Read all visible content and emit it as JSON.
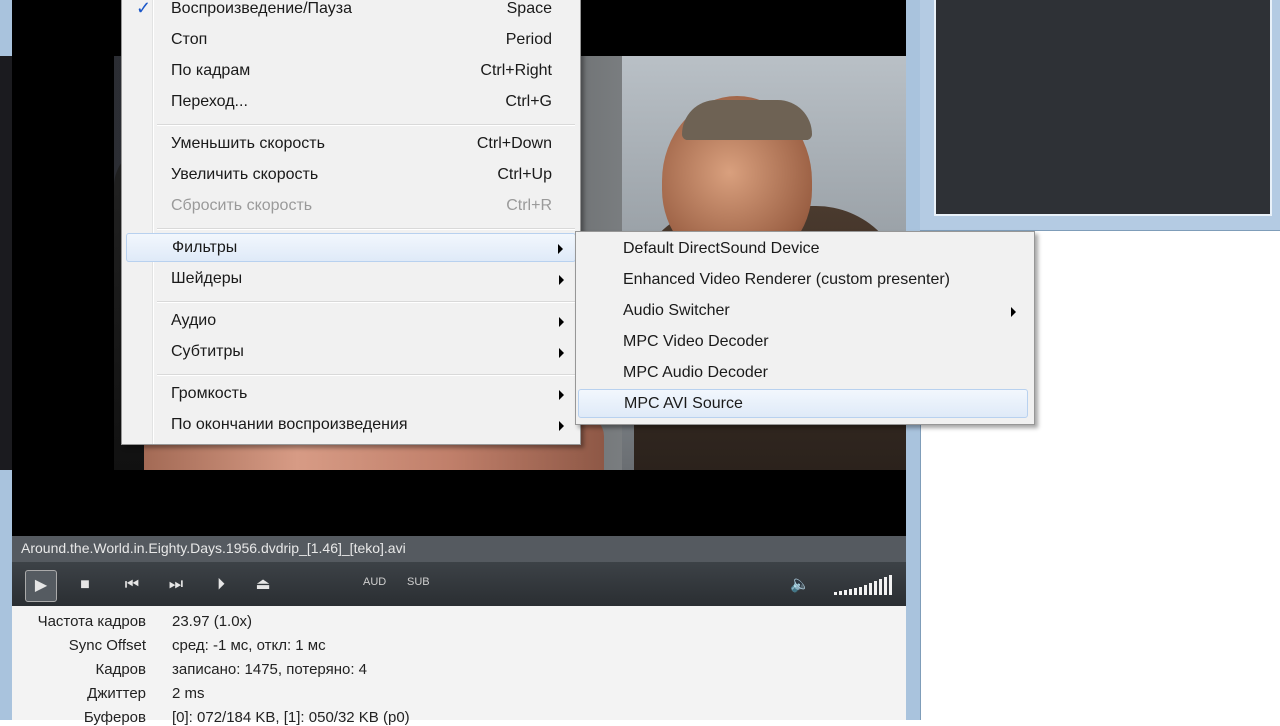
{
  "player": {
    "filename": "Around.the.World.in.Eighty.Days.1956.dvdrip_[1.46]_[teko].avi",
    "controls": {
      "play": "▶",
      "stop": "■",
      "prev": "⏮",
      "next": "⏭",
      "frame_step": "⏵",
      "eject": "⏏",
      "aud": "AUD",
      "sub": "SUB",
      "volume_icon": "🔈"
    },
    "stats": [
      {
        "label": "Частота кадров",
        "value": "23.97  (1.0x)"
      },
      {
        "label": "Sync Offset",
        "value": "сред: -1 мс, откл: 1 мс"
      },
      {
        "label": "Кадров",
        "value": "записано: 1475, потеряно: 4"
      },
      {
        "label": "Джиттер",
        "value": "2 ms"
      },
      {
        "label": "Буферов",
        "value": "[0]: 072/184 KB, [1]: 050/32 KB (p0)"
      }
    ]
  },
  "context_menu": {
    "items": [
      {
        "label": "Воспроизведение/Пауза",
        "accel": "Space",
        "checked": true
      },
      {
        "label": "Стоп",
        "accel": "Period"
      },
      {
        "label": "По кадрам",
        "accel": "Ctrl+Right"
      },
      {
        "label": "Переход...",
        "accel": "Ctrl+G"
      },
      {
        "label": "Уменьшить скорость",
        "accel": "Ctrl+Down"
      },
      {
        "label": "Увеличить скорость",
        "accel": "Ctrl+Up"
      },
      {
        "label": "Сбросить скорость",
        "accel": "Ctrl+R",
        "disabled": true
      },
      {
        "label": "Фильтры",
        "submenu": true,
        "active": true
      },
      {
        "label": "Шейдеры",
        "submenu": true
      },
      {
        "label": "Аудио",
        "submenu": true
      },
      {
        "label": "Субтитры",
        "submenu": true
      },
      {
        "label": "Громкость",
        "submenu": true
      },
      {
        "label": "По окончании воспроизведения",
        "submenu": true
      }
    ],
    "check_mark": "✓"
  },
  "filters_submenu": {
    "items": [
      {
        "label": "Default DirectSound Device"
      },
      {
        "label": "Enhanced Video Renderer (custom presenter)"
      },
      {
        "label": "Audio Switcher",
        "submenu": true
      },
      {
        "label": "MPC Video Decoder"
      },
      {
        "label": "MPC Audio Decoder"
      },
      {
        "label": "MPC AVI Source",
        "hover": true
      }
    ]
  },
  "colors": {
    "menu_bg": "#f1f1f1",
    "hover_border": "#b8d1ef",
    "frame_blue": "#a9c3dd"
  }
}
